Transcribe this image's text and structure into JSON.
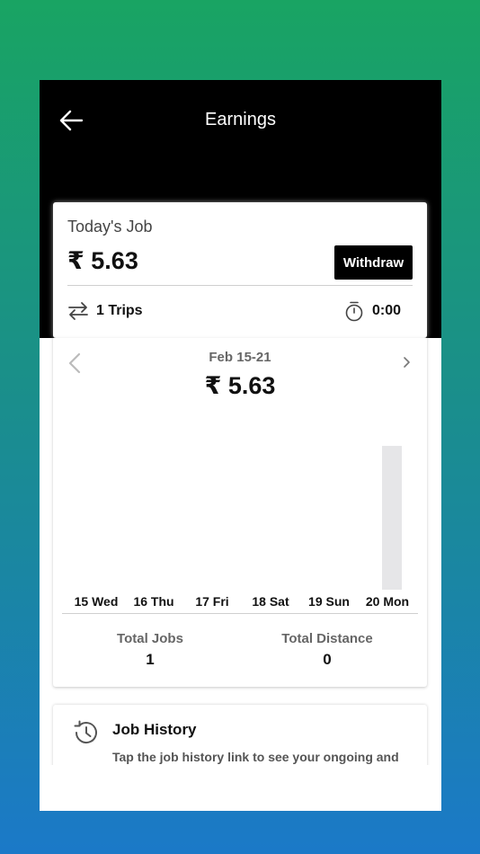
{
  "header": {
    "title": "Earnings",
    "back_icon": "arrow-left-icon"
  },
  "today": {
    "label": "Today's Job",
    "amount": "₹ 5.63",
    "withdraw_label": "Withdraw",
    "trips": "1 Trips",
    "trips_icon": "swap-arrows-icon",
    "time": "0:00",
    "time_icon": "stopwatch-icon"
  },
  "week": {
    "range": "Feb 15-21",
    "amount": "₹ 5.63",
    "prev_icon": "chevron-left-icon",
    "next_icon": "chevron-right-icon",
    "days": [
      {
        "label": "15 Wed",
        "value": 0
      },
      {
        "label": "16 Thu",
        "value": 0
      },
      {
        "label": "17 Fri",
        "value": 0
      },
      {
        "label": "18 Sat",
        "value": 0
      },
      {
        "label": "19 Sun",
        "value": 0
      },
      {
        "label": "20 Mon",
        "value": 5.63
      }
    ],
    "total_jobs_label": "Total Jobs",
    "total_jobs": "1",
    "total_distance_label": "Total Distance",
    "total_distance": "0"
  },
  "history": {
    "title": "Job History",
    "description": "Tap the job history link to see your ongoing and",
    "icon": "history-clock-icon"
  },
  "colors": {
    "header_bg": "#000000",
    "bar": "#e6e6e8",
    "gradient_top": "#19a463",
    "gradient_bottom": "#1b79c8"
  }
}
